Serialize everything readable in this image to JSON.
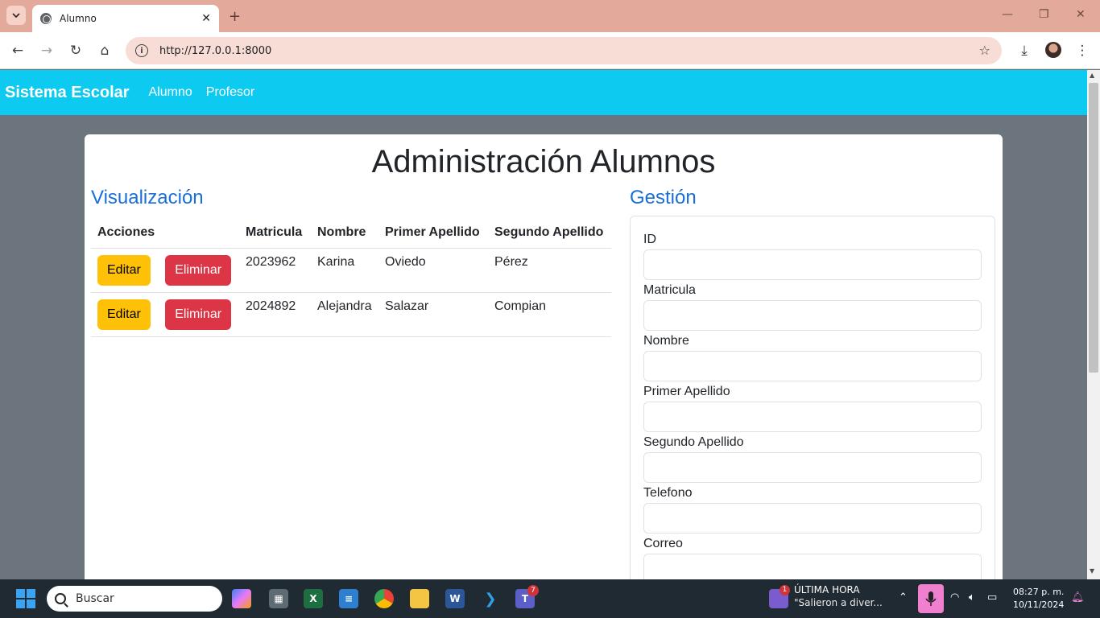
{
  "browser": {
    "tab_title": "Alumno",
    "url": "http://127.0.0.1:8000"
  },
  "navbar": {
    "brand": "Sistema Escolar",
    "links": [
      "Alumno",
      "Profesor"
    ]
  },
  "page": {
    "title": "Administración Alumnos",
    "left_heading": "Visualización",
    "right_heading": "Gestión"
  },
  "table": {
    "headers": [
      "Acciones",
      "Matricula",
      "Nombre",
      "Primer Apellido",
      "Segundo Apellido"
    ],
    "edit_label": "Editar",
    "delete_label": "Eliminar",
    "rows": [
      {
        "matricula": "2023962",
        "nombre": "Karina",
        "primer": "Oviedo",
        "segundo": "Pérez"
      },
      {
        "matricula": "2024892",
        "nombre": "Alejandra",
        "primer": "Salazar",
        "segundo": "Compian"
      }
    ]
  },
  "form": {
    "fields": [
      "ID",
      "Matricula",
      "Nombre",
      "Primer Apellido",
      "Segundo Apellido",
      "Telefono",
      "Correo"
    ]
  },
  "taskbar": {
    "search_placeholder": "Buscar",
    "news_title": "ÚLTIMA HORA",
    "news_text": "\"Salieron a diver...",
    "news_badge": "1",
    "teams_badge": "7",
    "time": "08:27 p. m.",
    "date": "10/11/2024"
  },
  "colors": {
    "navbar": "#0dcaf0",
    "heading": "#1a6fd6",
    "edit": "#ffc107",
    "delete": "#dc3545",
    "page_bg": "#6c757d"
  }
}
